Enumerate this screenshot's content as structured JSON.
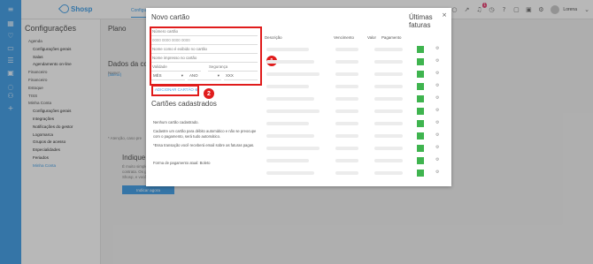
{
  "topbar": {
    "logo_text": "Shosp",
    "tabs": [
      "Configurações",
      "..."
    ],
    "user": "Lorena",
    "badge_count": "1"
  },
  "sidebar": {
    "title": "Configurações",
    "items": [
      {
        "label": "Agenda",
        "kind": "group"
      },
      {
        "label": "Configurações gerais",
        "kind": "sub"
      },
      {
        "label": "Salas",
        "kind": "sub"
      },
      {
        "label": "Agendamento on-line",
        "kind": "sub"
      },
      {
        "label": "Financeiro",
        "kind": "group"
      },
      {
        "label": "Financeiro",
        "kind": "group"
      },
      {
        "label": "Estoque",
        "kind": "group"
      },
      {
        "label": "TISS",
        "kind": "group"
      },
      {
        "label": "Minha Conta",
        "kind": "group"
      },
      {
        "label": "Configurações gerais",
        "kind": "sub"
      },
      {
        "label": "Integrações",
        "kind": "sub"
      },
      {
        "label": "Notificações do gestor",
        "kind": "sub"
      },
      {
        "label": "Logomarca",
        "kind": "sub"
      },
      {
        "label": "Grupos de acesso",
        "kind": "sub"
      },
      {
        "label": "Especialidades",
        "kind": "sub"
      },
      {
        "label": "Feriados",
        "kind": "sub"
      },
      {
        "label": "Minha Conta",
        "kind": "link"
      }
    ]
  },
  "main": {
    "plano_title": "Plano",
    "dados_title": "Dados da co",
    "nome_label": "Nome*",
    "alterar_label": "(alterar)",
    "note": "* Atenção, caso pre",
    "indique_title": "Indique e ga",
    "indique_text": [
      "É muito simples, v",
      "contrata. Os ganh",
      "Shosp, e você gan"
    ],
    "indique_button": "Indicar agora"
  },
  "modal": {
    "close": "×",
    "new_card_title": "Novo cartão",
    "card_number_label": "Número cartão",
    "card_number_value": "0000 0000 0000 0000",
    "name_as_shown": "Nome como é exibido no cartão",
    "name_printed": "Nome impresso no cartão",
    "validity_label": "Validade",
    "security_label": "Segurança",
    "month": "MÊS",
    "year": "ANO",
    "cvv": "XXX",
    "add_card_button": "ADICIONAR CARTÃO",
    "step1": "1",
    "step2": "2",
    "registered_title": "Cartões cadastrados",
    "no_card": "Nenhum cartão cadastrado.",
    "register_hint": "Cadastre um cartão para débito automático e não se preocupe com o pagamento, será tudo automático.",
    "transaction_hint": "*Essa transação você receberá email sobre as faturas pagas.",
    "payment_label": "Forma de pagamento atual: Boleto",
    "invoices_title": "Últimas faturas",
    "columns": [
      "Descrição",
      "Vencimento",
      "Valor",
      "Pagamento"
    ],
    "green": "#3fb44f",
    "accent": "#4aa3e8",
    "highlight": "#e01c1c"
  }
}
